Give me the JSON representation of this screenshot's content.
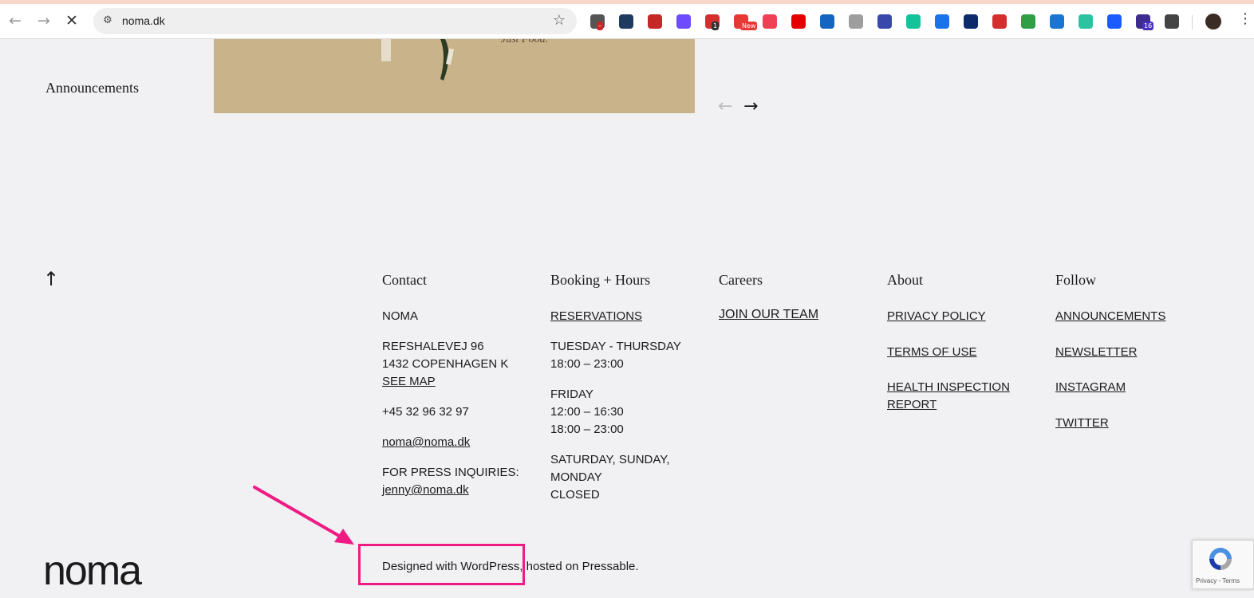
{
  "browser": {
    "url": "noma.dk",
    "nav": {
      "back": "←",
      "forward": "→",
      "stop": "✕"
    },
    "site_info_icon": "⚙",
    "star_icon": "☆",
    "menu_icon": "⋮",
    "extensions": [
      {
        "name": "ext-globe-icon",
        "color": "#555555",
        "badge": "–",
        "badge_color": "#c62828"
      },
      {
        "name": "ext-search-icon",
        "color": "#1e3a5f",
        "badge": "",
        "badge_color": ""
      },
      {
        "name": "ext-seo-icon",
        "color": "#c62828",
        "badge": "",
        "badge_color": ""
      },
      {
        "name": "ext-d-icon",
        "color": "#6d4cff",
        "badge": "",
        "badge_color": ""
      },
      {
        "name": "ext-calendar-icon",
        "color": "#d32f2f",
        "badge": "1",
        "badge_color": "#333333"
      },
      {
        "name": "ext-new-icon",
        "color": "#e53935",
        "badge": "New",
        "badge_color": "#e53935"
      },
      {
        "name": "ext-pocket-icon",
        "color": "#ef4056",
        "badge": "",
        "badge_color": ""
      },
      {
        "name": "ext-abp-icon",
        "color": "#e40000",
        "badge": "",
        "badge_color": ""
      },
      {
        "name": "ext-vpn-icon",
        "color": "#1565c0",
        "badge": "",
        "badge_color": ""
      },
      {
        "name": "ext-photo-icon",
        "color": "#9e9e9e",
        "badge": "",
        "badge_color": ""
      },
      {
        "name": "ext-blocks-icon",
        "color": "#3949ab",
        "badge": "",
        "badge_color": ""
      },
      {
        "name": "ext-grammarly-icon",
        "color": "#15c39a",
        "badge": "",
        "badge_color": ""
      },
      {
        "name": "ext-clock-icon",
        "color": "#1a73e8",
        "badge": "",
        "badge_color": ""
      },
      {
        "name": "ext-fingerprint-icon",
        "color": "#0d2b6b",
        "badge": "",
        "badge_color": ""
      },
      {
        "name": "ext-location-icon",
        "color": "#d32f2f",
        "badge": "",
        "badge_color": ""
      },
      {
        "name": "ext-shield-icon",
        "color": "#2e9f45",
        "badge": "",
        "badge_color": ""
      },
      {
        "name": "ext-printer-icon",
        "color": "#1976d2",
        "badge": "",
        "badge_color": ""
      },
      {
        "name": "ext-smile-icon",
        "color": "#2bc3a0",
        "badge": "",
        "badge_color": ""
      },
      {
        "name": "ext-square-icon",
        "color": "#1a5cff",
        "badge": "",
        "badge_color": ""
      },
      {
        "name": "ext-cap-icon",
        "color": "#3d2c8d",
        "badge": "16",
        "badge_color": "#4a2fbd"
      },
      {
        "name": "ext-puzzle-icon",
        "color": "#444444",
        "badge": "",
        "badge_color": ""
      }
    ]
  },
  "page": {
    "announcements_heading": "Announcements",
    "hero_caption": "Just Food.",
    "carousel": {
      "prev": "←",
      "next": "→"
    },
    "back_to_top": "↑",
    "footer": {
      "contact": {
        "title": "Contact",
        "name": "NOMA",
        "address_line1": "REFSHALEVEJ 96",
        "address_line2": "1432 COPENHAGEN K",
        "map_link": "SEE MAP",
        "phone": "+45 32 96 32 97",
        "email": "noma@noma.dk",
        "press_label": "FOR PRESS INQUIRIES:",
        "press_email": "jenny@noma.dk"
      },
      "booking": {
        "title": "Booking + Hours",
        "reservations": "RESERVATIONS",
        "tue_thu": "TUESDAY - THURSDAY",
        "tue_thu_hours": "18:00 – 23:00",
        "friday": "FRIDAY",
        "friday_hours1": "12:00 – 16:30",
        "friday_hours2": "18:00 – 23:00",
        "weekend": "SATURDAY, SUNDAY, MONDAY",
        "weekend_status": "CLOSED"
      },
      "careers": {
        "title": "Careers",
        "join": "JOIN OUR TEAM"
      },
      "about": {
        "title": "About",
        "privacy": "PRIVACY POLICY",
        "terms": "TERMS OF USE",
        "health": "HEALTH INSPECTION REPORT"
      },
      "follow": {
        "title": "Follow",
        "announcements": "ANNOUNCEMENTS",
        "newsletter": "NEWSLETTER",
        "instagram": "INSTAGRAM",
        "twitter": "TWITTER"
      },
      "credit": "Designed with WordPress, hosted on Pressable.",
      "logo": "noma"
    },
    "recaptcha": {
      "text": "Privacy - Terms"
    }
  },
  "colors": {
    "highlight": "#ef1b84",
    "page_bg": "#f1f1f4"
  }
}
